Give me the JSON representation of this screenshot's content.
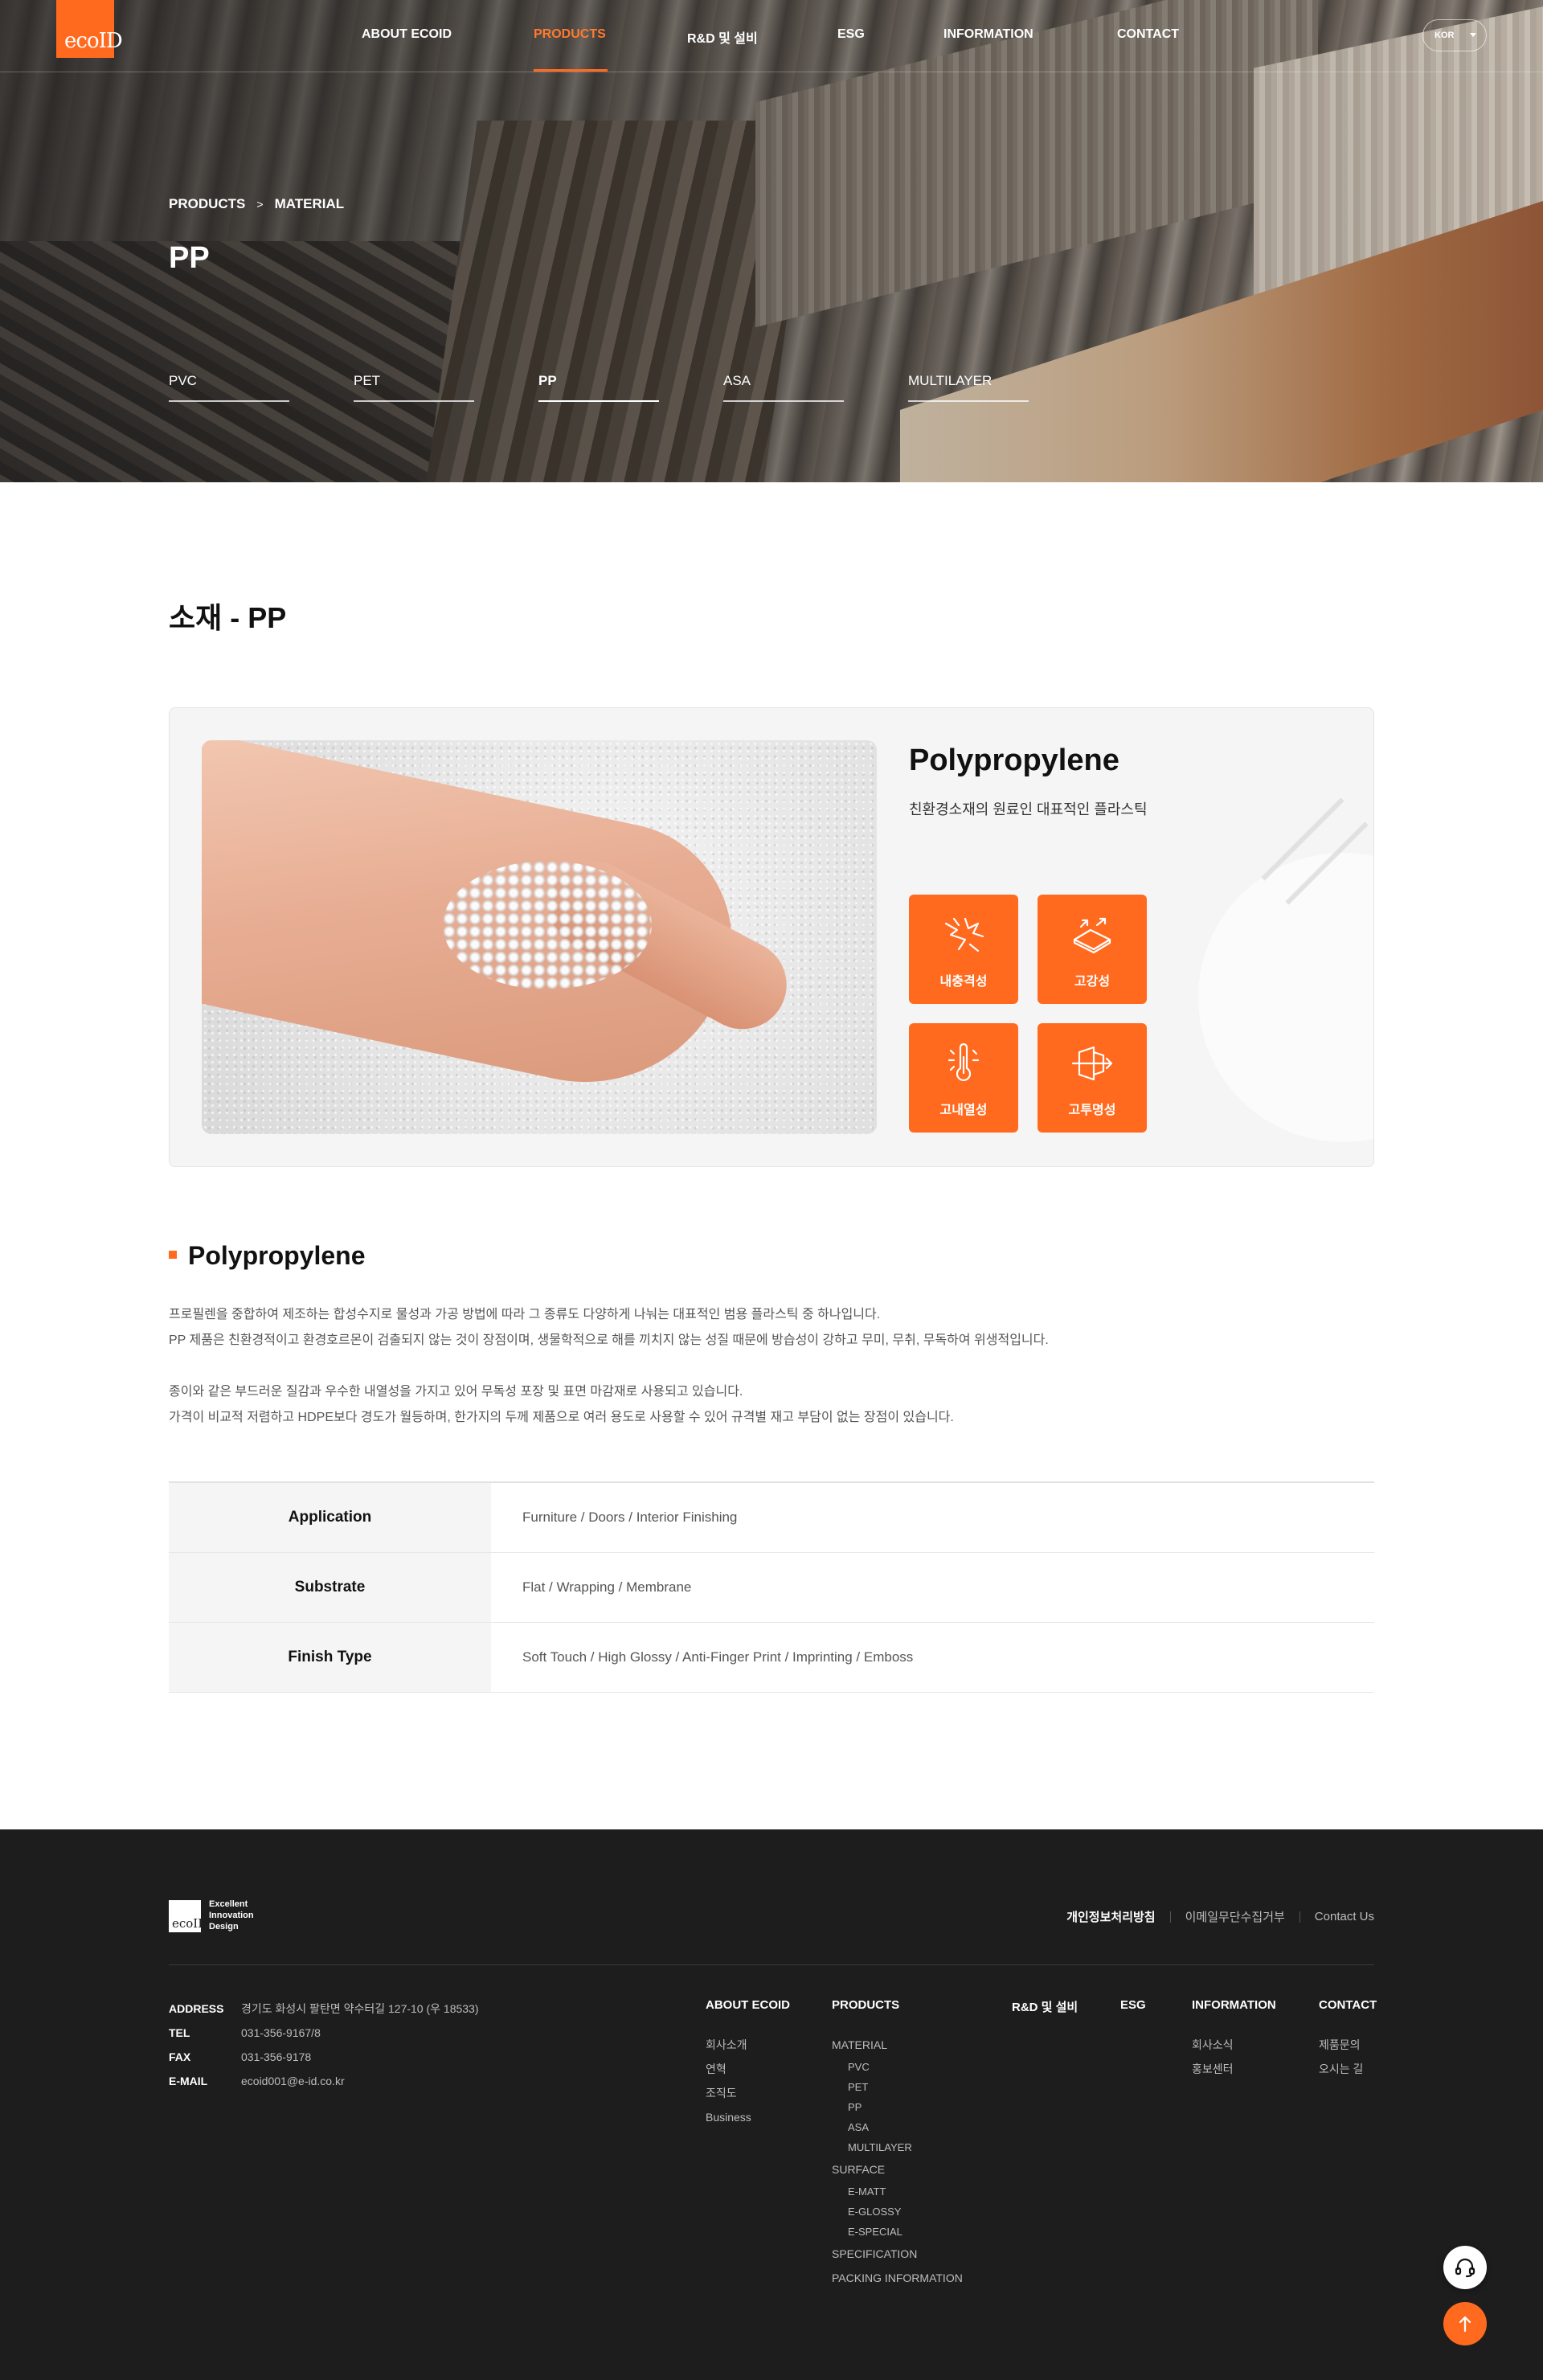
{
  "header": {
    "logo_text": "ecoID",
    "nav": [
      {
        "label": "ABOUT ECOID"
      },
      {
        "label": "PRODUCTS"
      },
      {
        "label": "R&D 및 설비"
      },
      {
        "label": "ESG"
      },
      {
        "label": "INFORMATION"
      },
      {
        "label": "CONTACT"
      }
    ],
    "active_nav": "PRODUCTS",
    "language": "KOR"
  },
  "hero": {
    "breadcrumb": [
      "PRODUCTS",
      "MATERIAL"
    ],
    "title": "PP",
    "subtabs": [
      "PVC",
      "PET",
      "PP",
      "ASA",
      "MULTILAYER"
    ],
    "active_subtab": "PP"
  },
  "main": {
    "section_title": "소재 - PP",
    "card": {
      "title": "Polypropylene",
      "subtitle": "친환경소재의 원료인 대표적인 플라스틱",
      "features": [
        {
          "label": "내충격성",
          "icon": "impact-icon"
        },
        {
          "label": "고강성",
          "icon": "rigidity-icon"
        },
        {
          "label": "고내열성",
          "icon": "heat-resistance-icon"
        },
        {
          "label": "고투명성",
          "icon": "transparency-icon"
        }
      ]
    },
    "detail_title": "Polypropylene",
    "description": [
      "프로필렌을 중합하여 제조하는 합성수지로 물성과 가공 방법에 따라 그 종류도 다양하게 나눠는 대표적인 범용 플라스틱 중 하나입니다.",
      "PP 제품은 친환경적이고 환경호르몬이 검출되지 않는 것이 장점이며, 생물학적으로 해를 끼치지 않는 성질 때문에 방습성이 강하고 무미, 무취, 무독하여 위생적입니다.",
      "종이와 같은 부드러운 질감과 우수한 내열성을 가지고 있어 무독성 포장 및 표면 마감재로 사용되고 있습니다.",
      "가격이 비교적 저렴하고 HDPE보다 경도가 월등하며, 한가지의 두께 제품으로 여러 용도로 사용할 수 있어 규격별 재고 부담이 없는 장점이 있습니다."
    ],
    "spec_table": [
      {
        "key": "Application",
        "value": "Furniture / Doors / Interior Finishing"
      },
      {
        "key": "Substrate",
        "value": "Flat / Wrapping / Membrane"
      },
      {
        "key": "Finish Type",
        "value": "Soft Touch / High Glossy / Anti-Finger Print / Imprinting / Emboss"
      }
    ]
  },
  "footer": {
    "logo_text": "ecoID",
    "slogan": [
      "Excellent",
      "Innovation",
      "Design"
    ],
    "links": [
      "개인정보처리방침",
      "이메일무단수집거부",
      "Contact Us"
    ],
    "address": [
      {
        "key": "ADDRESS",
        "value": "경기도 화성시 팔탄면 약수터길 127-10 (우 18533)"
      },
      {
        "key": "TEL",
        "value": "031-356-9167/8"
      },
      {
        "key": "FAX",
        "value": "031-356-9178"
      },
      {
        "key": "E-MAIL",
        "value": "ecoid001@e-id.co.kr"
      }
    ],
    "columns": {
      "about": {
        "head": "ABOUT ECOID",
        "items": [
          "회사소개",
          "연혁",
          "조직도",
          "Business"
        ]
      },
      "products": {
        "head": "PRODUCTS",
        "material": "MATERIAL",
        "material_items": [
          "PVC",
          "PET",
          "PP",
          "ASA",
          "MULTILAYER"
        ],
        "surface": "SURFACE",
        "surface_items": [
          "E-MATT",
          "E-GLOSSY",
          "E-SPECIAL"
        ],
        "extra": [
          "SPECIFICATION",
          "PACKING INFORMATION"
        ]
      },
      "rnd": {
        "head": "R&D 및 설비"
      },
      "esg": {
        "head": "ESG"
      },
      "information": {
        "head": "INFORMATION",
        "items": [
          "회사소식",
          "홍보센터"
        ]
      },
      "contact": {
        "head": "CONTACT",
        "items": [
          "제품문의",
          "오시는 길"
        ]
      }
    }
  },
  "colors": {
    "accent": "#ff6a1f",
    "footer_bg": "#1d1d1d",
    "card_bg": "#f5f5f5"
  },
  "floating": {
    "support_icon": "headset-icon",
    "top_icon": "arrow-up-icon"
  }
}
